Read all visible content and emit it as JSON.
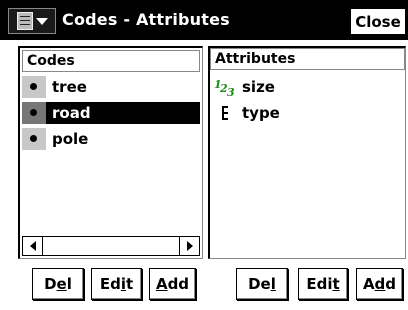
{
  "window": {
    "title": "Codes - Attributes",
    "close_label": "Close"
  },
  "codes_panel": {
    "header": "Codes",
    "items": [
      {
        "label": "tree",
        "selected": false
      },
      {
        "label": "road",
        "selected": true
      },
      {
        "label": "pole",
        "selected": false
      }
    ],
    "buttons": {
      "del": {
        "pre": "D",
        "u": "e",
        "post": "l"
      },
      "edit": {
        "pre": "Ed",
        "u": "i",
        "post": "t"
      },
      "add": {
        "pre": "",
        "u": "A",
        "post": "dd"
      }
    }
  },
  "attributes_panel": {
    "header": "Attributes",
    "items": [
      {
        "label": "size",
        "icon": "numeric-attribute-icon"
      },
      {
        "label": "type",
        "icon": "list-attribute-icon"
      }
    ],
    "buttons": {
      "del": {
        "pre": "De",
        "u": "l",
        "post": ""
      },
      "edit": {
        "pre": "Edi",
        "u": "t",
        "post": ""
      },
      "add": {
        "pre": "A",
        "u": "d",
        "post": "d"
      }
    }
  },
  "colors": {
    "titlebar_bg": "#000000",
    "selection_bg": "#000000",
    "marker_bg": "#c8c8c8",
    "numeric_icon": "#1a8a1a"
  }
}
